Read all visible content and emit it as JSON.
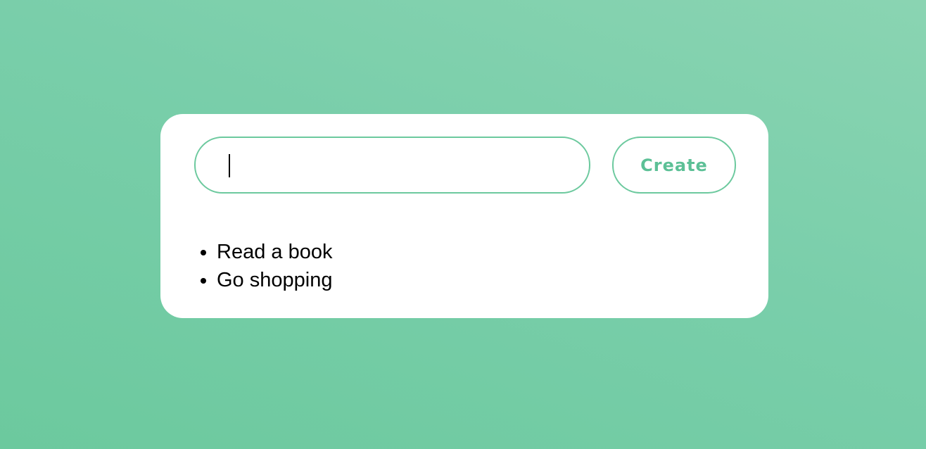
{
  "input": {
    "value": "",
    "placeholder": ""
  },
  "create_button": {
    "label": "Create"
  },
  "todos": [
    {
      "label": "Read a book"
    },
    {
      "label": "Go shopping"
    }
  ],
  "colors": {
    "accent": "#6cc99e",
    "button_text": "#5cc096",
    "card": "#ffffff"
  }
}
